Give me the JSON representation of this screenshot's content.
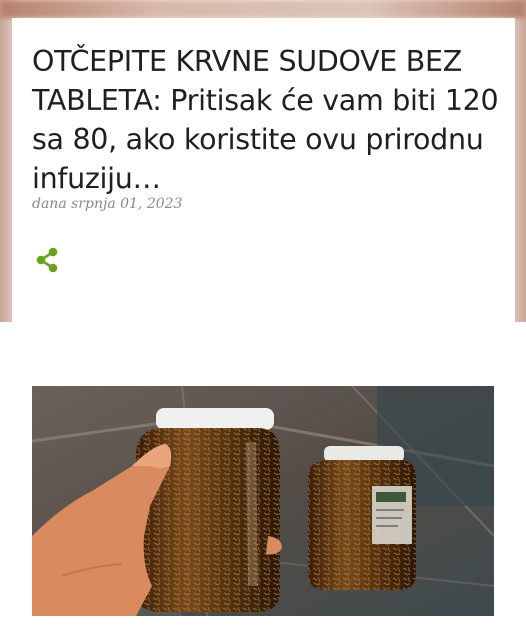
{
  "post": {
    "title": "OTČEPITE KRVNE SUDOVE BEZ TABLETA: Pritisak će vam biti 120 sa 80, ako koristite ovu prirodnu infuziju…",
    "date": "dana srpnja 01, 2023"
  },
  "share": {
    "icon": "share-icon",
    "color": "#6aa121"
  },
  "image": {
    "subject": "hand-holding-jars"
  }
}
